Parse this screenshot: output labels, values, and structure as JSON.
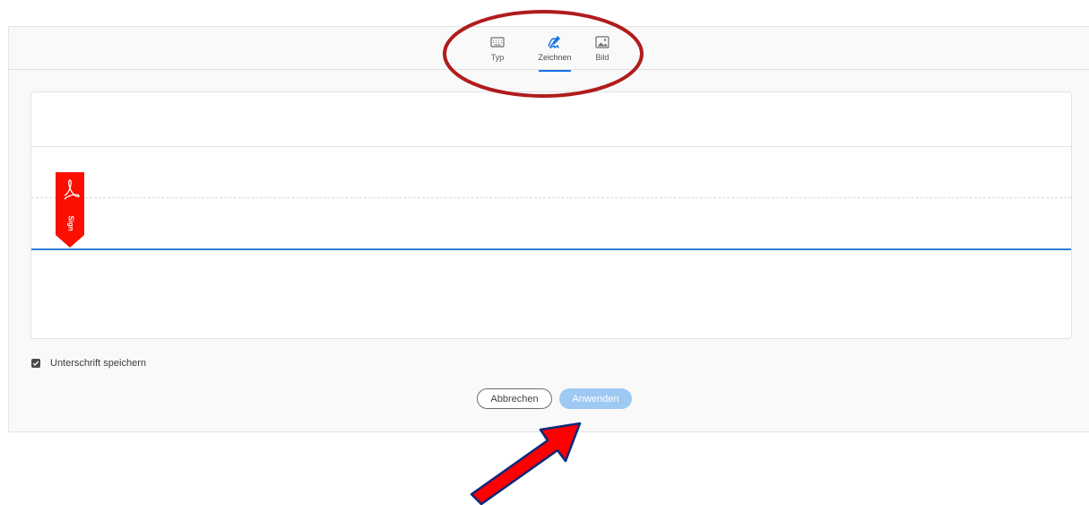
{
  "tabs": [
    {
      "label": "Typ",
      "icon": "keyboard-icon",
      "active": false
    },
    {
      "label": "Zeichnen",
      "icon": "pen-draw-icon",
      "active": true
    },
    {
      "label": "Bild",
      "icon": "image-icon",
      "active": false
    }
  ],
  "canvas": {
    "badge_text": "Sign",
    "badge_icon": "acrobat-logo-icon",
    "badge_color": "#fa0f00"
  },
  "save_option": {
    "label": "Unterschrift speichern",
    "checked": true
  },
  "buttons": {
    "cancel": "Abbrechen",
    "apply": "Anwenden"
  },
  "colors": {
    "accent": "#1473e6",
    "apply_disabled": "#9ec9f3",
    "annotation_red": "#b01c1c",
    "arrow_fill": "#ff0000",
    "arrow_stroke": "#0b2a7a"
  }
}
